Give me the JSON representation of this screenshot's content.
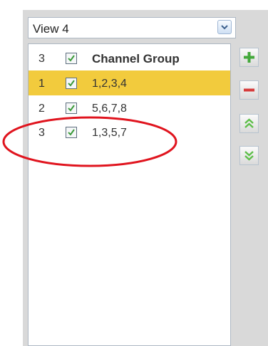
{
  "view_select": {
    "value": "View 4"
  },
  "channel_list": {
    "header": {
      "index": "3",
      "checked": true,
      "label": "Channel Group"
    },
    "rows": [
      {
        "index": "1",
        "checked": true,
        "label": "1,2,3,4",
        "selected": true
      },
      {
        "index": "2",
        "checked": true,
        "label": "5,6,7,8",
        "selected": false
      },
      {
        "index": "3",
        "checked": true,
        "label": "1,3,5,7",
        "selected": false
      }
    ]
  },
  "side_buttons": [
    {
      "name": "add-button",
      "icon": "plus-icon"
    },
    {
      "name": "remove-button",
      "icon": "minus-icon"
    },
    {
      "name": "move-up-button",
      "icon": "double-chevron-up-icon"
    },
    {
      "name": "move-down-button",
      "icon": "double-chevron-down-icon"
    }
  ],
  "colors": {
    "panel_bg": "#d9d9d9",
    "selected_row": "#f2cb3d",
    "checkmark": "#3a9a3a",
    "add": "#43a83b",
    "remove": "#d63b3b",
    "move": "#5ebf4a",
    "annotation_ellipse": "#e0141e"
  },
  "annotation": {
    "shape": "ellipse",
    "highlights_row": 3
  }
}
